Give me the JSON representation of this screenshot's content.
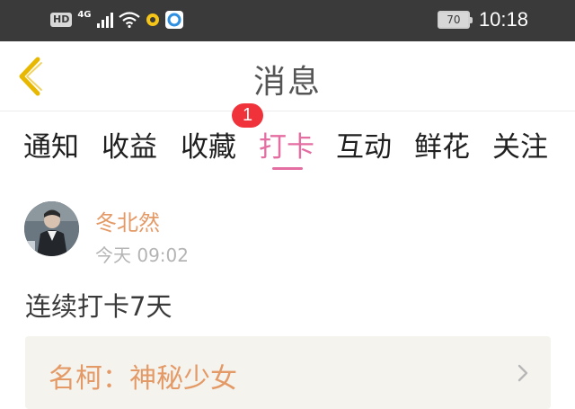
{
  "status_bar": {
    "hd_label": "HD",
    "network_label": "4G",
    "battery_level": "70",
    "time": "10:18"
  },
  "header": {
    "title": "消息",
    "back_icon": "chevron-left-icon"
  },
  "tabs": [
    {
      "label": "通知",
      "active": false
    },
    {
      "label": "收益",
      "active": false
    },
    {
      "label": "收藏",
      "active": false
    },
    {
      "label": "打卡",
      "active": true
    },
    {
      "label": "互动",
      "active": false
    },
    {
      "label": "鲜花",
      "active": false
    },
    {
      "label": "关注",
      "active": false
    }
  ],
  "tab_badge": {
    "count": "1"
  },
  "message": {
    "username": "冬北然",
    "time": "今天 09:02",
    "text": "连续打卡7天",
    "card_title": "名柯：神秘少女"
  },
  "colors": {
    "accent": "#e46ea2",
    "orange": "#e49a67",
    "badge": "#f0333a",
    "back_icon": "#e8b800",
    "status_bar": "#3a3a3a"
  }
}
